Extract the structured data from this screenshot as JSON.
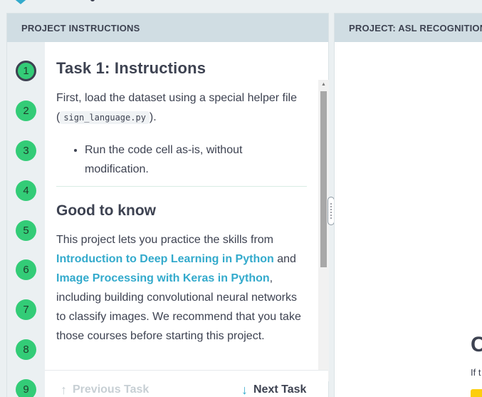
{
  "left_panel": {
    "header": "PROJECT INSTRUCTIONS",
    "tasks": [
      "1",
      "2",
      "3",
      "4",
      "5",
      "6",
      "7",
      "8",
      "9"
    ],
    "active_task": 1,
    "task_title": "Task 1: Instructions",
    "intro_before": "First, load the dataset using a special helper file (",
    "intro_code": "sign_language.py",
    "intro_after": ").",
    "bullet": "Run the code cell as-is, without modification.",
    "good_to_know_title": "Good to know",
    "gtk_text_1": "This project lets you practice the skills from ",
    "gtk_link_1": "Introduction to Deep Learning in Python",
    "gtk_text_2": " and ",
    "gtk_link_2": "Image Processing with Keras in Python",
    "gtk_text_3": ", including building convolutional neural networks to classify images. We recommend that you take those courses before starting this project.",
    "prev_task": "Previous Task",
    "next_task": "Next Task"
  },
  "right_panel": {
    "header": "PROJECT: ASL RECOGNITION W",
    "big_letter": "C",
    "small_text": "If t"
  },
  "colors": {
    "accent": "#33aacc",
    "task_green": "#33cc77",
    "header_bg": "#d0dde3",
    "text": "#3d4251",
    "yellow": "#fcce0d"
  }
}
